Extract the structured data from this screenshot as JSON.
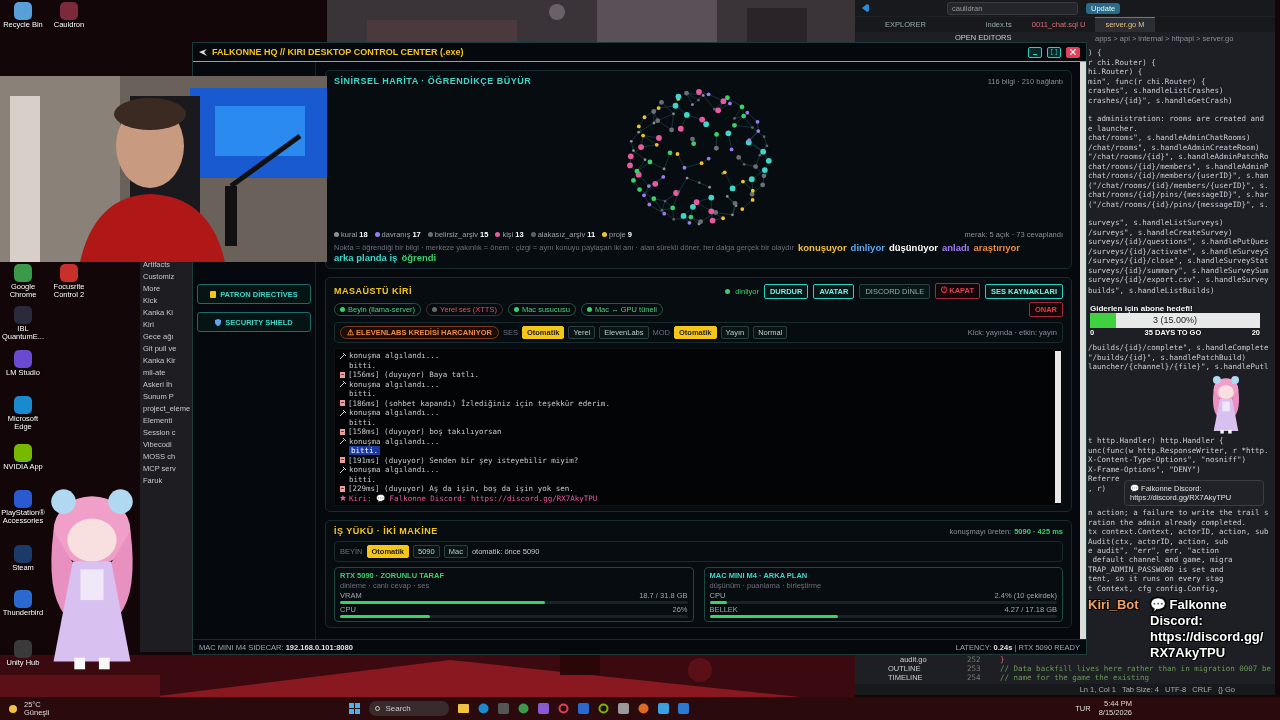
{
  "desktop_icons": [
    {
      "label": "Recycle Bin",
      "color": "#5aa0d8"
    },
    {
      "label": "Cauldron",
      "color": "#7a2a3a"
    },
    {
      "label": "Google Chrome",
      "color": "#3a9a4a"
    },
    {
      "label": "Focusrite Control 2",
      "color": "#c8302a"
    },
    {
      "label": "IBL QuantumE...",
      "color": "#2a2a3a"
    },
    {
      "label": "LM Studio",
      "color": "#6a4ad0"
    },
    {
      "label": "Microsoft Edge",
      "color": "#1a8ad0"
    },
    {
      "label": "NVIDIA App",
      "color": "#76b900"
    },
    {
      "label": "PlayStation® Accessories",
      "color": "#2a5ad0"
    },
    {
      "label": "Steam",
      "color": "#1a3a6a"
    },
    {
      "label": "Thunderbird",
      "color": "#2a6ad0"
    },
    {
      "label": "Unity Hub",
      "color": "#3a3a3a"
    }
  ],
  "side_app": {
    "items": [
      "Artifacts",
      "Customiz",
      "More",
      "Kick",
      "Kanka Ki",
      "Kiri",
      "Gece ağı",
      "Git pull ve",
      "Kanka Kir",
      "mil-ate",
      "Askeri İh",
      "Sunum P",
      "project_eleme",
      "Elementi",
      "Session c",
      "Vibecodi",
      "MOSS ch",
      "MCP serv",
      "Faruk"
    ]
  },
  "editor": {
    "search": "caulidran",
    "update": "Update",
    "tabs": [
      {
        "label": "EXPLORER",
        "kind": "panel",
        "selected": false
      },
      {
        "label": "index.ts",
        "kind": "ts",
        "selected": false
      },
      {
        "label": "0011_chat.sql U",
        "kind": "sql",
        "selected": false
      },
      {
        "label": "server.go M",
        "kind": "go",
        "selected": true
      }
    ],
    "explorer_heading": "OPEN EDITORS",
    "breadcrumb": "apps > api > internal > httpapi > server.go",
    "code_blocks": [
      [
        ") {",
        "r chi.Router) {",
        "hi.Router) {",
        "min\", func(r chi.Router) {",
        "crashes\", s.handleListCrashes)",
        "crashes/{id}\", s.handleGetCrash)"
      ],
      [
        "t administration: rooms are created and",
        "e launcher.",
        "chat/rooms\", s.handleAdminChatRooms)",
        "/chat/rooms\", s.handleAdminCreateRoom)",
        "\"/chat/rooms/{id}\", s.handleAdminPatchRo",
        "chat/rooms/{id}/members\", s.handleAdminP",
        "chat/rooms/{id}/members/{userID}\", s.han",
        "(\"/chat/rooms/{id}/members/{userID}\", s.",
        "chat/rooms/{id}/pins/{messageID}\", s.har",
        "(\"/chat/rooms/{id}/pins/{messageID}\", s."
      ],
      [
        "surveys\", s.handleListSurveys)",
        "/surveys\", s.handleCreateSurvey)",
        "surveys/{id}/questions\", s.handlePutQues",
        "/surveys/{id}/activate\", s.handleSurveyS",
        "/surveys/{id}/close\", s.handleSurveyStat",
        "surveys/{id}/summary\", s.handleSurveySum",
        "surveys/{id}/export.csv\", s.handleSurvey"
      ],
      [
        "builds\", s.handleListBuilds)"
      ],
      [
        "/builds/{id}/complete\", s.handleComplete",
        "\"/builds/{id}\", s.handlePatchBuild)",
        "launcher/{channel}/{file}\", s.handlePutl"
      ],
      [
        "t http.Handler) http.Handler {",
        "unc(func(w http.ResponseWriter, r *http.",
        "X-Content-Type-Options\", \"nosniff\")",
        "X-Frame-Options\", \"DENY\")",
        "Referre",
        ", r)"
      ],
      [
        "n action; a failure to write the trail s",
        "ration the admin already completed.",
        "tx context.Context, actorID, action, sub",
        "Audit(ctx, actorID, action, sub",
        "e audit\", \"err\", err, \"action"
      ],
      [
        " default channel and game, migra",
        "TRAP_ADMIN_PASSWORD is set and",
        "tent, so it runs on every stag",
        "t Context, cfg config.Config,"
      ]
    ],
    "bottom": {
      "file": "audit.go",
      "sections": [
        "OUTLINE",
        "TIMELINE"
      ],
      "line_numbers": [
        "252",
        "253",
        "254"
      ],
      "lines": [
        "}",
        "// Data backfill lives here rather than in migration 0007 be",
        "// name for the game the existing"
      ]
    },
    "status_bar": [
      "Ln 1, Col 1",
      "Tab Size: 4",
      "UTF-8",
      "CRLF",
      "{} Go"
    ]
  },
  "window": {
    "title": "FALKONNE HQ // KIRI DESKTOP CONTROL CENTER (.exe)",
    "sidebar": [
      {
        "label": "PATRON DİRECTİVES",
        "kind": "scroll"
      },
      {
        "label": "SECURITY SHIELD",
        "kind": "shield"
      }
    ],
    "neural_map": {
      "title": "SİNİRSEL HARİTA · ÖĞRENDİKÇE BÜYÜR",
      "stats": "116 bilgi · 210 bağlantı",
      "legend": [
        {
          "label": "kural",
          "count": "18",
          "color": "#8a8f98"
        },
        {
          "label": "davranış",
          "count": "17",
          "color": "#9b7cf0"
        },
        {
          "label": "belirsiz_arşiv",
          "count": "15",
          "color": "#6b7078"
        },
        {
          "label": "kişi",
          "count": "13",
          "color": "#e85aa0"
        },
        {
          "label": "alakasız_arşiv",
          "count": "11",
          "color": "#5d6068"
        },
        {
          "label": "proje",
          "count": "9",
          "color": "#f2c230"
        }
      ],
      "curiosity": "merak: 5 açık · 73 cevaplandı",
      "caption": "Nokta = öğrendiği bir bilgi · merkeze yakınlık = önem · çizgi = aynı konuyu paylaşan iki anı · alan sürekli döner, her dalga gerçek bir olaydır",
      "activity_states": [
        {
          "label": "konuşuyor",
          "color": "#f2c230"
        },
        {
          "label": "dinliyor",
          "color": "#5aa8f0"
        },
        {
          "label": "düşünüyor",
          "color": "#ffffff"
        },
        {
          "label": "anladı",
          "color": "#a07cf0"
        },
        {
          "label": "araştırıyor",
          "color": "#f08a3c"
        },
        {
          "label": "arka planda iş",
          "color": "#3fd6c8"
        },
        {
          "label": "öğrendi",
          "color": "#3ad06a"
        }
      ]
    },
    "desktop_kiri": {
      "title": "MASAÜSTÜ KİRİ",
      "status": "dinliyor",
      "buttons": [
        {
          "label": "DURDUR",
          "kind": "primary"
        },
        {
          "label": "AVATAR",
          "kind": "primary"
        },
        {
          "label": "DISCORD DİNLE",
          "kind": "muted"
        },
        {
          "label": "⏻ KAPAT",
          "kind": "danger"
        },
        {
          "label": "SES KAYNAKLARI",
          "kind": "primary"
        }
      ],
      "repair_button": {
        "label": "ONAR",
        "kind": "danger"
      },
      "services": [
        {
          "label": "Beyin (llama-server)",
          "on": true
        },
        {
          "label": "Yerel ses (XTTS)",
          "on": false
        },
        {
          "label": "Mac susucusu",
          "on": true
        },
        {
          "label": "Mac ↔ GPU tüneli",
          "on": true
        }
      ],
      "warning": "⚠ ELEVENLABS KREDİSİ HARCANIYOR",
      "voice": {
        "label": "SES",
        "options": [
          {
            "label": "Otomatik",
            "selected": true
          },
          {
            "label": "Yerel",
            "selected": false
          },
          {
            "label": "ElevenLabs",
            "selected": false
          }
        ]
      },
      "mode": {
        "label": "MOD",
        "options": [
          {
            "label": "Otomatik",
            "selected": true
          },
          {
            "label": "Yayın",
            "selected": false
          },
          {
            "label": "Normal",
            "selected": false
          }
        ]
      },
      "kick_status": "Kick: yayında · etkin: yayın",
      "log": [
        {
          "kind": "detect",
          "text": "konuşma algılandı...",
          "highlighted": false
        },
        {
          "kind": "done",
          "text": "bitti.",
          "highlighted": false
        },
        {
          "kind": "heard",
          "text": "[156ms] (duyuyor) Baya tatlı.",
          "highlighted": false
        },
        {
          "kind": "detect",
          "text": "konuşma algılandı...",
          "highlighted": false
        },
        {
          "kind": "done",
          "text": "bitti.",
          "highlighted": false
        },
        {
          "kind": "heard",
          "text": "[186ms] (sohbet kapandı) İzlediğiniz için teşekkür ederim.",
          "highlighted": false
        },
        {
          "kind": "detect",
          "text": "konuşma algılandı...",
          "highlighted": false
        },
        {
          "kind": "done",
          "text": "bitti.",
          "highlighted": false
        },
        {
          "kind": "heard",
          "text": "[158ms] (duyuyor) boş takılıyorsan",
          "highlighted": false
        },
        {
          "kind": "detect",
          "text": "konuşma algılandı...",
          "highlighted": false
        },
        {
          "kind": "done",
          "text": "bitti.",
          "highlighted": true
        },
        {
          "kind": "heard",
          "text": "[191ms] (duyuyor) Senden bir şey isteyebilir miyim?",
          "highlighted": false
        },
        {
          "kind": "detect",
          "text": "konuşma algılandı...",
          "highlighted": false
        },
        {
          "kind": "done",
          "text": "bitti.",
          "highlighted": false
        },
        {
          "kind": "heard",
          "text": "[229ms] (duyuyor) Aş da işin, boş da işin yok sen.",
          "highlighted": false
        },
        {
          "kind": "kiri",
          "text": "Kiri: 💬 Falkonne Discord: https://discord.gg/RX7AkyTPU",
          "highlighted": false
        }
      ]
    },
    "workload": {
      "title": "İŞ YÜKÜ · İKİ MAKİNE",
      "producer_label": "konuşmayı üreten:",
      "producer": "5090 · 425 ms",
      "brain": {
        "label": "BEYİN",
        "options": [
          {
            "label": "Otomatik",
            "selected": true
          },
          {
            "label": "5090",
            "selected": false
          },
          {
            "label": "Mac",
            "selected": false
          }
        ],
        "note": "otomatik: önce 5090"
      },
      "machines": [
        {
          "name": "RTX 5090 · ZORUNLU TARAF",
          "roles": "dinleme · canlı cevap · ses",
          "meters": [
            {
              "label": "VRAM",
              "reading": "18.7 / 31.8 GB",
              "level": 0.59
            },
            {
              "label": "CPU",
              "reading": "26%",
              "level": 0.26
            }
          ]
        },
        {
          "name": "MAC MINI M4 · ARKA PLAN",
          "roles": "düşünüm · puanlama · birleştirme",
          "meters": [
            {
              "label": "CPU",
              "reading": "2.4% (10 çekirdek)",
              "level": 0.05
            },
            {
              "label": "BELLEK",
              "reading": "4.27 / 17.18 GB",
              "level": 0.37
            }
          ]
        }
      ]
    },
    "status_left_label": "MAC MINI M4 SIDECAR:",
    "status_left": "192.168.0.101:8080",
    "status_right_label": "LATENCY:",
    "status_right": "0.24s",
    "status_right_tail": "| RTX 5090 READY"
  },
  "tooltip": {
    "text": "💬 Falkonne Discord: https://discord.gg/RX7AkyTPU"
  },
  "sub_goal": {
    "title": "Giderlen için abone hedefi!",
    "reading": "3 (15.00%)",
    "level": 0.15,
    "min": "0",
    "max": "20",
    "remaining": "35 DAYS TO GO"
  },
  "chat_overlay": {
    "user": "Kiri_Bot",
    "message": "💬 Falkonne Discord: https://discord.gg/RX7AkyTPU"
  },
  "taskbar": {
    "weather_temp": "25°C",
    "weather_text": "Güneşli",
    "search": "Search",
    "language": "TUR",
    "time": "5:44 PM",
    "date": "8/15/2026"
  }
}
